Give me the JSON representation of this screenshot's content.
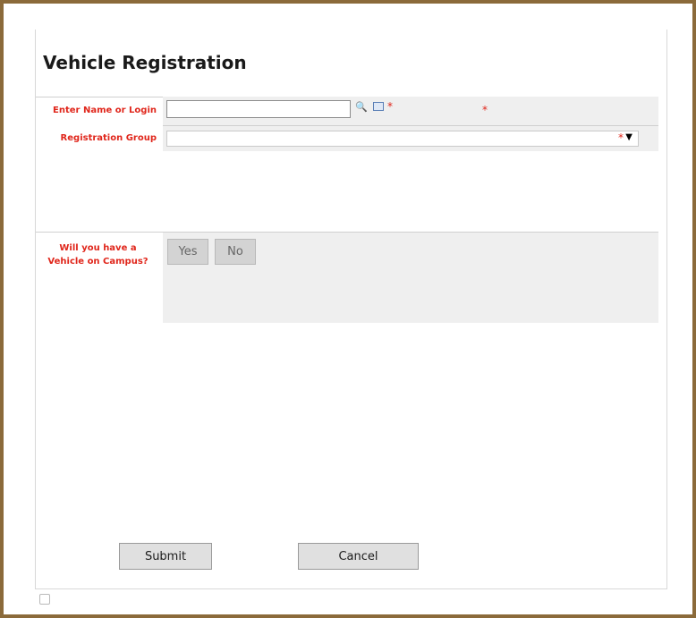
{
  "form": {
    "title": "Vehicle Registration",
    "name_label": "Enter Name or Login",
    "name_value": "",
    "group_label": "Registration Group",
    "group_value": "",
    "required_mark": "*",
    "vehicle_question": "Will you have a Vehicle on Campus?",
    "yes_label": "Yes",
    "no_label": "No",
    "submit_label": "Submit",
    "cancel_label": "Cancel"
  }
}
